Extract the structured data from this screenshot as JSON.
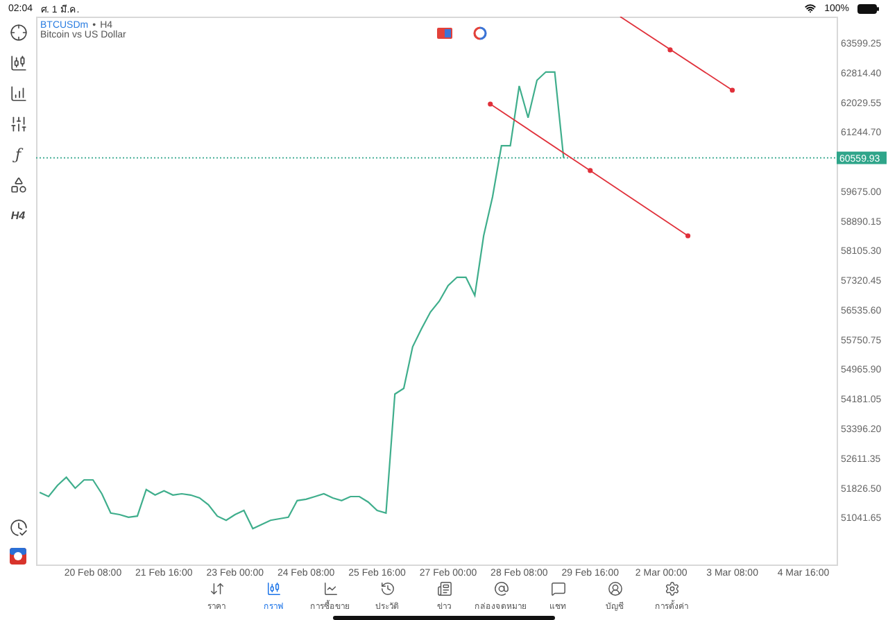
{
  "status_bar": {
    "time": "02:04",
    "date": "ศ. 1 มี.ค.",
    "battery": "100%"
  },
  "sidebar": {
    "function_label": "ƒ",
    "timeframe": "H4"
  },
  "chart_header": {
    "separator": "•",
    "timeframe": "H4",
    "description": "Bitcoin vs US Dollar"
  },
  "chart_data": {
    "type": "line",
    "categories": [
      null,
      null,
      null,
      null,
      null,
      null,
      "20 Feb 08:00",
      null,
      null,
      null,
      null,
      null,
      null,
      null,
      "21 Feb 16:00",
      null,
      null,
      null,
      null,
      null,
      null,
      null,
      "23 Feb 00:00",
      null,
      null,
      null,
      null,
      null,
      null,
      null,
      "24 Feb 08:00",
      null,
      null,
      null,
      null,
      null,
      null,
      null,
      "25 Feb 16:00",
      null,
      null,
      null,
      null,
      null,
      null,
      null,
      "27 Feb 00:00",
      null,
      null,
      null,
      null,
      null,
      null,
      null,
      "28 Feb 08:00",
      null,
      null,
      null,
      null,
      null,
      null,
      null,
      "29 Feb 16:00",
      null,
      null,
      null,
      null,
      null,
      null,
      null,
      "2 Mar 00:00",
      null,
      null,
      null,
      null,
      null,
      null,
      null,
      "3 Mar 08:00",
      null,
      null,
      null,
      null,
      null,
      null,
      null,
      "4 Mar 16:00"
    ],
    "series": [
      {
        "name": "BTCUSDm",
        "color": "#3fae8c",
        "values": [
          51710,
          51600,
          51890,
          52110,
          51820,
          52040,
          52040,
          51670,
          51160,
          51120,
          51050,
          51080,
          51780,
          51640,
          51750,
          51640,
          51670,
          51640,
          51560,
          51380,
          51080,
          50970,
          51120,
          51230,
          50750,
          50860,
          50970,
          51010,
          51050,
          51490,
          51530,
          51600,
          51670,
          51560,
          51490,
          51600,
          51600,
          51450,
          51230,
          51160,
          54310,
          54460,
          55560,
          56040,
          56480,
          56770,
          57180,
          57400,
          57400,
          56920,
          58500,
          59530,
          60880,
          60880,
          62460,
          61620,
          62610,
          62830,
          62830,
          60560,
          null,
          null,
          null,
          null,
          null,
          null,
          null,
          null,
          null,
          null,
          null,
          null,
          null,
          null,
          null,
          null,
          null,
          null,
          null,
          null,
          null,
          null,
          null,
          null,
          null,
          null,
          null
        ]
      }
    ],
    "ylim": [
      49800,
      64296
    ],
    "yticks": [
      {
        "value": 63599.25,
        "label": "63599.25"
      },
      {
        "value": 62814.4,
        "label": "62814.40"
      },
      {
        "value": 62029.55,
        "label": "62029.55"
      },
      {
        "value": 61244.7,
        "label": "61244.70"
      },
      {
        "value": 59675,
        "label": "59675.00"
      },
      {
        "value": 58890.15,
        "label": "58890.15"
      },
      {
        "value": 58105.3,
        "label": "58105.30"
      },
      {
        "value": 57320.45,
        "label": "57320.45"
      },
      {
        "value": 56535.6,
        "label": "56535.60"
      },
      {
        "value": 55750.75,
        "label": "55750.75"
      },
      {
        "value": 54965.9,
        "label": "54965.90"
      },
      {
        "value": 54181.05,
        "label": "54181.05"
      },
      {
        "value": 53396.2,
        "label": "53396.20"
      },
      {
        "value": 52611.35,
        "label": "52611.35"
      },
      {
        "value": 51826.5,
        "label": "51826.50"
      },
      {
        "value": 51041.65,
        "label": "51041.65"
      }
    ]
  },
  "current_price": {
    "label": "60559.93"
  },
  "tabs": [
    {
      "label": "ราคา",
      "selected": false
    },
    {
      "label": "กราฟ",
      "selected": true
    },
    {
      "label": "การซื้อขาย",
      "selected": false
    },
    {
      "label": "ประวัติ",
      "selected": false
    },
    {
      "label": "ข่าว",
      "selected": false
    },
    {
      "label": "กล่องจดหมาย",
      "selected": false
    },
    {
      "label": "แชท",
      "selected": false
    },
    {
      "label": "บัญชี",
      "selected": false
    },
    {
      "label": "การตั้งค่า",
      "selected": false
    }
  ]
}
